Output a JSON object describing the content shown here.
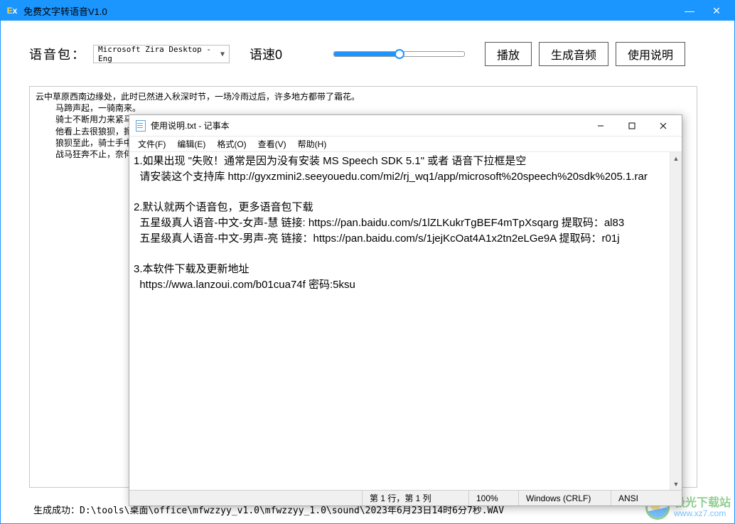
{
  "main": {
    "title": "免费文字转语音V1.0",
    "voice_label": "语音包：",
    "voice_selected": "Microsoft Zira Desktop - Eng",
    "speed_label": "语速0",
    "btn_play": "播放",
    "btn_generate": "生成音频",
    "btn_help": "使用说明",
    "status": "生成成功：D:\\tools\\桌面\\office\\mfwzzyy_v1.0\\mfwzzyy_1.0\\sound\\2023年6月23日14时6分7秒.WAV",
    "text_lines": [
      {
        "cls": "",
        "t": "云中草原西南边缘处，此时已然进入秋深时节，一场冷雨过后，许多地方都带了霜花。"
      },
      {
        "cls": "indent1",
        "t": "马蹄声起，一骑南来。"
      },
      {
        "cls": "indent1",
        "t": "骑士不断用力来紧马腹"
      },
      {
        "cls": "indent1",
        "t": "他看上去很狼狈，掀能                                                                                                                                                                                                                                                    斑血迹。"
      },
      {
        "cls": "indent1",
        "t": "狼狈至此，骑士手中，"
      },
      {
        "cls": "indent1",
        "t": "战马狂奔不止，奈何本"
      }
    ]
  },
  "notepad": {
    "title": "使用说明.txt - 记事本",
    "menu": [
      "文件(F)",
      "编辑(E)",
      "格式(O)",
      "查看(V)",
      "帮助(H)"
    ],
    "content": "1.如果出现 \"失败！通常是因为没有安装 MS Speech SDK 5.1\" 或者 语音下拉框是空\n  请安装这个支持库 http://gyxzmini2.seeyouedu.com/mi2/rj_wq1/app/microsoft%20speech%20sdk%205.1.rar\n\n2.默认就两个语音包，更多语音包下载\n  五星级真人语音-中文-女声-慧 链接: https://pan.baidu.com/s/1lZLKukrTgBEF4mTpXsqarg 提取码：al83\n  五星级真人语音-中文-男声-亮 链接：https://pan.baidu.com/s/1jejKcOat4A1x2tn2eLGe9A 提取码：r01j\n\n3.本软件下载及更新地址\n  https://wwa.lanzoui.com/b01cua74f 密码:5ksu",
    "status": {
      "pos": "第 1 行，第 1 列",
      "zoom": "100%",
      "eol": "Windows (CRLF)",
      "enc": "ANSI"
    }
  },
  "watermark": {
    "name": "极光下载站",
    "url": "www.xz7.com"
  }
}
